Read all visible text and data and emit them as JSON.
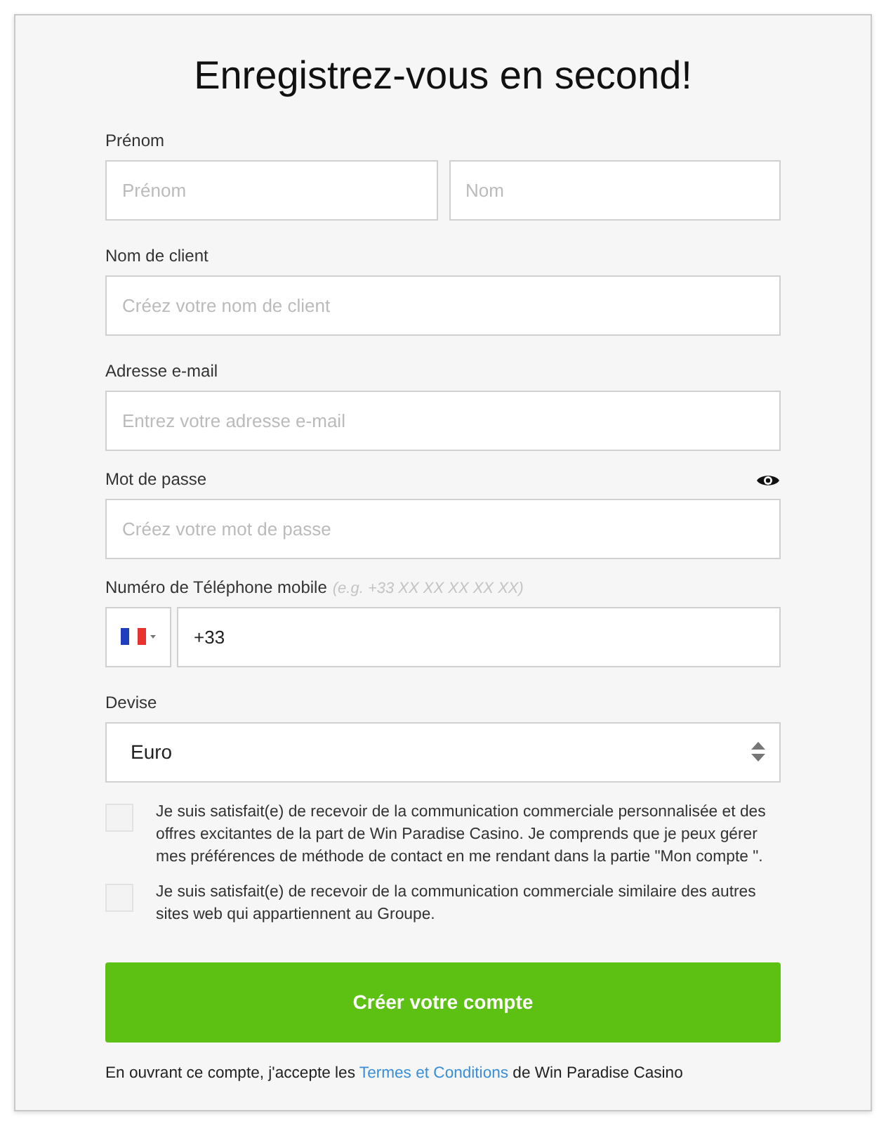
{
  "title": "Enregistrez-vous en second!",
  "name_row": {
    "label": "Prénom",
    "fields": [
      {
        "placeholder": "Prénom"
      },
      {
        "placeholder": "Nom"
      }
    ]
  },
  "username": {
    "label": "Nom de client",
    "placeholder": "Créez votre nom de client"
  },
  "email": {
    "label": "Adresse e-mail",
    "placeholder": "Entrez votre adresse e-mail"
  },
  "password": {
    "label": "Mot de passe",
    "placeholder": "Créez votre mot de passe"
  },
  "phone": {
    "label": "Numéro de Téléphone mobile",
    "hint": "(e.g. +33 XX XX XX XX XX)",
    "value": "+33"
  },
  "currency": {
    "label": "Devise",
    "value": "Euro"
  },
  "consents": [
    {
      "text": "Je suis satisfait(e) de recevoir de la communication commerciale personnalisée et des offres excitantes de la part de Win Paradise Casino. Je comprends que je peux gérer mes préférences de méthode de contact en me rendant dans la partie \"Mon compte \".",
      "checked": false
    },
    {
      "text": "Je suis satisfait(e) de recevoir de la communication commerciale similaire des autres sites web qui appartiennent au Groupe.",
      "checked": false
    }
  ],
  "submit": "Créer votre compte",
  "terms": {
    "before": "En ouvrant ce compte, j'accepte les",
    "link": "Termes et Conditions",
    "after": "de Win Paradise Casino"
  }
}
